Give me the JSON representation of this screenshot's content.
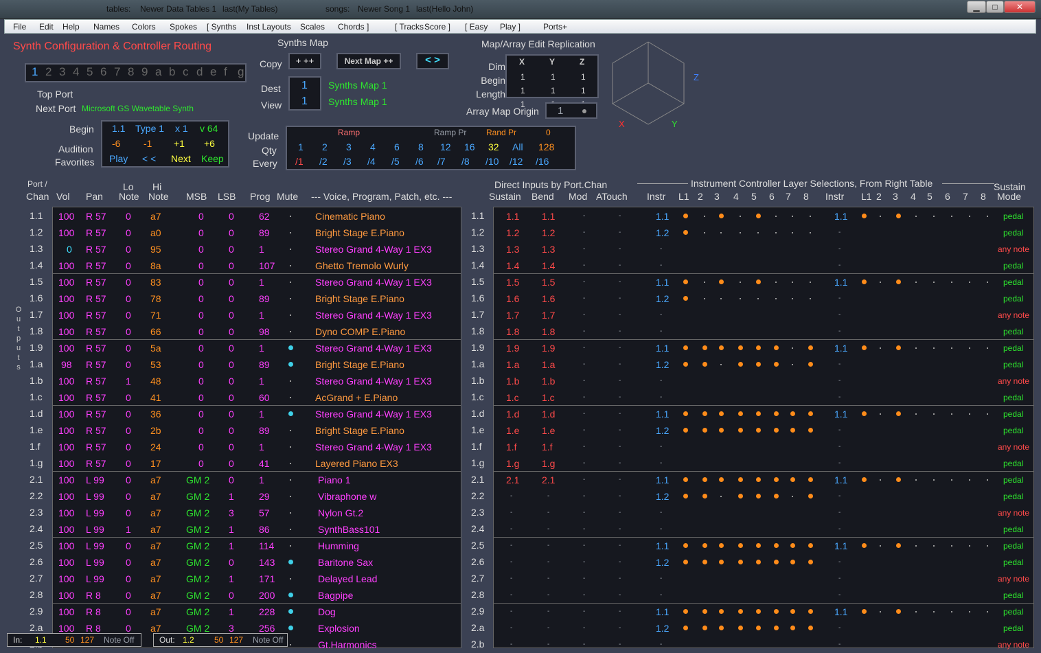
{
  "titlebar": {
    "tables_label": "tables:",
    "tables_value": "Newer Data Tables 1",
    "tables_last": "last(My Tables)",
    "songs_label": "songs:",
    "songs_value": "Newer Song 1",
    "songs_last": "last(Hello John)",
    "minimize": "▁",
    "maximize": "□",
    "close": "✕"
  },
  "menu": [
    "File",
    "Edit",
    "Help",
    "Names",
    "Colors",
    "Spokes",
    "[  Synths",
    "Inst Layouts",
    "Scales",
    "Chords  ]",
    "[  Tracks",
    "Score  ]",
    "[  Easy",
    "Play  ]",
    "Ports+"
  ],
  "config": {
    "title": "Synth Configuration & Controller Routing",
    "ports": [
      "1",
      "2",
      "3",
      "4",
      "5",
      "6",
      "7",
      "8",
      "9",
      "a",
      "b",
      "c",
      "d",
      "e",
      "f",
      "g"
    ],
    "top_port_label": "Top Port",
    "next_port_label": "Next Port",
    "next_port_value": "Microsoft GS Wavetable Synth",
    "begin_label": "Begin",
    "audition_label": "Audition",
    "favorites_label": "Favorites",
    "begin_vals": [
      "1.1",
      "Type 1",
      "x 1",
      "v 64"
    ],
    "audition_vals": [
      "-6",
      "-1",
      "+1",
      "+6"
    ],
    "fav_vals": [
      "Play",
      "<  <",
      "Next",
      "Keep"
    ]
  },
  "synthsmap": {
    "title": "Synths Map",
    "copy_label": "Copy",
    "copy_btn": "+  ++",
    "next_map_btn": "Next Map ++",
    "nav_btn": "<  >",
    "dest_label": "Dest",
    "view_label": "View",
    "dest_value": "1",
    "view_value": "1",
    "dest_name": "Synths Map 1",
    "view_name": "Synths Map 1"
  },
  "replication": {
    "title": "Map/Array Edit Replication",
    "headers": [
      "X",
      "Y",
      "Z"
    ],
    "rows": [
      {
        "label": "Dim",
        "vals": [
          "1",
          "1",
          "1"
        ]
      },
      {
        "label": "Begin",
        "vals": [
          "1",
          "1",
          "1"
        ]
      },
      {
        "label": "Length",
        "vals": [
          "1",
          "1",
          "1"
        ]
      }
    ],
    "origin_label": "Array Map Origin",
    "origin_value": "1",
    "axis_x": "X",
    "axis_y": "Y",
    "axis_z": "Z"
  },
  "update": {
    "update_label": "Update",
    "qty_label": "Qty",
    "every_label": "Every",
    "ramp": "Ramp",
    "ramp_pr": "Ramp Pr",
    "rand_pr": "Rand Pr",
    "zero": "0",
    "qty": [
      "1",
      "2",
      "3",
      "4",
      "6",
      "8",
      "12",
      "16",
      "32",
      "All",
      "128"
    ],
    "every": [
      "/1",
      "/2",
      "/3",
      "/4",
      "/5",
      "/6",
      "/7",
      "/8",
      "/10",
      "/12",
      "/16"
    ]
  },
  "left_headers": {
    "port": "Port /",
    "chan": "Chan",
    "vol": "Vol",
    "pan": "Pan",
    "lo1": "Lo",
    "lo2": "Note",
    "hi1": "Hi",
    "hi2": "Note",
    "msb": "MSB",
    "lsb": "LSB",
    "prog": "Prog",
    "mute": "Mute",
    "voice": "--- Voice, Program, Patch, etc. ---",
    "outputs": "Outputs"
  },
  "right_headers": {
    "direct": "Direct Inputs by Port.Chan",
    "sustain": "Sustain",
    "bend": "Bend",
    "mod": "Mod",
    "atouch": "ATouch",
    "layer_title": "Instrument Controller Layer Selections, From Right Table",
    "instr": "Instr",
    "layers": [
      "L1",
      "2",
      "3",
      "4",
      "5",
      "6",
      "7",
      "8"
    ],
    "sustain_mode1": "Sustain",
    "sustain_mode2": "Mode"
  },
  "rows": [
    {
      "pc": "1.1",
      "vol": "100",
      "pan": "R 57",
      "lo": "0",
      "hi": "a7",
      "msb": "0",
      "lsb": "0",
      "prog": "62",
      "mute": 0,
      "voice": "Cinematic Piano",
      "di": 1,
      "inst": "1.1",
      "lyr": "10101000",
      "inst2": "1.1",
      "lyr2": "10100000",
      "mode": "pedal"
    },
    {
      "pc": "1.2",
      "vol": "100",
      "pan": "R 57",
      "lo": "0",
      "hi": "a0",
      "msb": "0",
      "lsb": "0",
      "prog": "89",
      "mute": 0,
      "voice": "Bright Stage E.Piano",
      "di": 1,
      "inst": "1.2",
      "lyr": "10000000",
      "inst2": "",
      "lyr2": "",
      "mode": "pedal"
    },
    {
      "pc": "1.3",
      "vol": "0",
      "pan": "R 57",
      "lo": "0",
      "hi": "95",
      "msb": "0",
      "lsb": "0",
      "prog": "1",
      "mute": 0,
      "voice": "Stereo Grand 4-Way 1 EX3",
      "di": 1,
      "inst": "",
      "lyr": "",
      "inst2": "",
      "lyr2": "",
      "mode": "any note"
    },
    {
      "pc": "1.4",
      "vol": "100",
      "pan": "R 57",
      "lo": "0",
      "hi": "8a",
      "msb": "0",
      "lsb": "0",
      "prog": "107",
      "mute": 0,
      "voice": "Ghetto Tremolo Wurly",
      "di": 1,
      "inst": "",
      "lyr": "",
      "inst2": "",
      "lyr2": "",
      "mode": "pedal"
    },
    {
      "pc": "1.5",
      "vol": "100",
      "pan": "R 57",
      "lo": "0",
      "hi": "83",
      "msb": "0",
      "lsb": "0",
      "prog": "1",
      "mute": 0,
      "voice": "Stereo Grand 4-Way 1 EX3",
      "di": 1,
      "inst": "1.1",
      "lyr": "10101000",
      "inst2": "1.1",
      "lyr2": "10100000",
      "mode": "pedal"
    },
    {
      "pc": "1.6",
      "vol": "100",
      "pan": "R 57",
      "lo": "0",
      "hi": "78",
      "msb": "0",
      "lsb": "0",
      "prog": "89",
      "mute": 0,
      "voice": "Bright Stage E.Piano",
      "di": 1,
      "inst": "1.2",
      "lyr": "10000000",
      "inst2": "",
      "lyr2": "",
      "mode": "pedal"
    },
    {
      "pc": "1.7",
      "vol": "100",
      "pan": "R 57",
      "lo": "0",
      "hi": "71",
      "msb": "0",
      "lsb": "0",
      "prog": "1",
      "mute": 0,
      "voice": "Stereo Grand 4-Way 1 EX3",
      "di": 1,
      "inst": "",
      "lyr": "",
      "inst2": "",
      "lyr2": "",
      "mode": "any note"
    },
    {
      "pc": "1.8",
      "vol": "100",
      "pan": "R 57",
      "lo": "0",
      "hi": "66",
      "msb": "0",
      "lsb": "0",
      "prog": "98",
      "mute": 0,
      "voice": "Dyno COMP E.Piano",
      "di": 1,
      "inst": "",
      "lyr": "",
      "inst2": "",
      "lyr2": "",
      "mode": "pedal"
    },
    {
      "pc": "1.9",
      "vol": "100",
      "pan": "R 57",
      "lo": "0",
      "hi": "5a",
      "msb": "0",
      "lsb": "0",
      "prog": "1",
      "mute": 1,
      "voice": "Stereo Grand 4-Way 1 EX3",
      "di": 1,
      "inst": "1.1",
      "lyr": "11111101",
      "inst2": "1.1",
      "lyr2": "10100000",
      "mode": "pedal"
    },
    {
      "pc": "1.a",
      "vol": "98",
      "pan": "R 57",
      "lo": "0",
      "hi": "53",
      "msb": "0",
      "lsb": "0",
      "prog": "89",
      "mute": 1,
      "voice": "Bright Stage E.Piano",
      "di": 1,
      "inst": "1.2",
      "lyr": "11011101",
      "inst2": "",
      "lyr2": "",
      "mode": "pedal"
    },
    {
      "pc": "1.b",
      "vol": "100",
      "pan": "R 57",
      "lo": "1",
      "hi": "48",
      "msb": "0",
      "lsb": "0",
      "prog": "1",
      "mute": 0,
      "voice": "Stereo Grand 4-Way 1 EX3",
      "di": 1,
      "inst": "",
      "lyr": "",
      "inst2": "",
      "lyr2": "",
      "mode": "any note"
    },
    {
      "pc": "1.c",
      "vol": "100",
      "pan": "R 57",
      "lo": "0",
      "hi": "41",
      "msb": "0",
      "lsb": "0",
      "prog": "60",
      "mute": 0,
      "voice": "AcGrand + E.Piano",
      "di": 1,
      "inst": "",
      "lyr": "",
      "inst2": "",
      "lyr2": "",
      "mode": "pedal"
    },
    {
      "pc": "1.d",
      "vol": "100",
      "pan": "R 57",
      "lo": "0",
      "hi": "36",
      "msb": "0",
      "lsb": "0",
      "prog": "1",
      "mute": 1,
      "voice": "Stereo Grand 4-Way 1 EX3",
      "di": 1,
      "inst": "1.1",
      "lyr": "11111111",
      "inst2": "1.1",
      "lyr2": "10100000",
      "mode": "pedal"
    },
    {
      "pc": "1.e",
      "vol": "100",
      "pan": "R 57",
      "lo": "0",
      "hi": "2b",
      "msb": "0",
      "lsb": "0",
      "prog": "89",
      "mute": 0,
      "voice": "Bright Stage E.Piano",
      "di": 1,
      "inst": "1.2",
      "lyr": "11111111",
      "inst2": "",
      "lyr2": "",
      "mode": "pedal"
    },
    {
      "pc": "1.f",
      "vol": "100",
      "pan": "R 57",
      "lo": "0",
      "hi": "24",
      "msb": "0",
      "lsb": "0",
      "prog": "1",
      "mute": 0,
      "voice": "Stereo Grand 4-Way 1 EX3",
      "di": 1,
      "inst": "",
      "lyr": "",
      "inst2": "",
      "lyr2": "",
      "mode": "any note"
    },
    {
      "pc": "1.g",
      "vol": "100",
      "pan": "R 57",
      "lo": "0",
      "hi": "17",
      "msb": "0",
      "lsb": "0",
      "prog": "41",
      "mute": 0,
      "voice": "Layered Piano EX3",
      "di": 1,
      "inst": "",
      "lyr": "",
      "inst2": "",
      "lyr2": "",
      "mode": "pedal"
    },
    {
      "pc": "2.1",
      "vol": "100",
      "pan": "L 99",
      "lo": "0",
      "hi": "a7",
      "msb": "GM 2",
      "lsb": "0",
      "prog": "1",
      "mute": 0,
      "voice": "Piano 1",
      "di": 1,
      "inst": "1.1",
      "lyr": "11111111",
      "inst2": "1.1",
      "lyr2": "10100000",
      "mode": "pedal"
    },
    {
      "pc": "2.2",
      "vol": "100",
      "pan": "L 99",
      "lo": "0",
      "hi": "a7",
      "msb": "GM 2",
      "lsb": "1",
      "prog": "29",
      "mute": 0,
      "voice": "Vibraphone w",
      "di": 0,
      "inst": "1.2",
      "lyr": "11011101",
      "inst2": "",
      "lyr2": "",
      "mode": "pedal"
    },
    {
      "pc": "2.3",
      "vol": "100",
      "pan": "L 99",
      "lo": "0",
      "hi": "a7",
      "msb": "GM 2",
      "lsb": "3",
      "prog": "57",
      "mute": 0,
      "voice": "Nylon Gt.2",
      "di": 0,
      "inst": "",
      "lyr": "",
      "inst2": "",
      "lyr2": "",
      "mode": "any note"
    },
    {
      "pc": "2.4",
      "vol": "100",
      "pan": "L 99",
      "lo": "1",
      "hi": "a7",
      "msb": "GM 2",
      "lsb": "1",
      "prog": "86",
      "mute": 0,
      "voice": "SynthBass101",
      "di": 0,
      "inst": "",
      "lyr": "",
      "inst2": "",
      "lyr2": "",
      "mode": "pedal"
    },
    {
      "pc": "2.5",
      "vol": "100",
      "pan": "L 99",
      "lo": "0",
      "hi": "a7",
      "msb": "GM 2",
      "lsb": "1",
      "prog": "114",
      "mute": 0,
      "voice": "Humming",
      "di": 0,
      "inst": "1.1",
      "lyr": "11111111",
      "inst2": "1.1",
      "lyr2": "10100000",
      "mode": "pedal"
    },
    {
      "pc": "2.6",
      "vol": "100",
      "pan": "L 99",
      "lo": "0",
      "hi": "a7",
      "msb": "GM 2",
      "lsb": "0",
      "prog": "143",
      "mute": 1,
      "voice": "Baritone Sax",
      "di": 0,
      "inst": "1.2",
      "lyr": "11111111",
      "inst2": "",
      "lyr2": "",
      "mode": "pedal"
    },
    {
      "pc": "2.7",
      "vol": "100",
      "pan": "L 99",
      "lo": "0",
      "hi": "a7",
      "msb": "GM 2",
      "lsb": "1",
      "prog": "171",
      "mute": 0,
      "voice": "Delayed Lead",
      "di": 0,
      "inst": "",
      "lyr": "",
      "inst2": "",
      "lyr2": "",
      "mode": "any note"
    },
    {
      "pc": "2.8",
      "vol": "100",
      "pan": "R  8",
      "lo": "0",
      "hi": "a7",
      "msb": "GM 2",
      "lsb": "0",
      "prog": "200",
      "mute": 1,
      "voice": "Bagpipe",
      "di": 0,
      "inst": "",
      "lyr": "",
      "inst2": "",
      "lyr2": "",
      "mode": "pedal"
    },
    {
      "pc": "2.9",
      "vol": "100",
      "pan": "R  8",
      "lo": "0",
      "hi": "a7",
      "msb": "GM 2",
      "lsb": "1",
      "prog": "228",
      "mute": 1,
      "voice": "Dog",
      "di": 0,
      "inst": "1.1",
      "lyr": "11111111",
      "inst2": "1.1",
      "lyr2": "10100000",
      "mode": "pedal"
    },
    {
      "pc": "2.a",
      "vol": "100",
      "pan": "R  8",
      "lo": "0",
      "hi": "a7",
      "msb": "GM 2",
      "lsb": "3",
      "prog": "256",
      "mute": 1,
      "voice": "Explosion",
      "di": 0,
      "inst": "1.2",
      "lyr": "11111111",
      "inst2": "",
      "lyr2": "",
      "mode": "pedal"
    },
    {
      "pc": "2.b",
      "vol": "",
      "pan": "",
      "lo": "",
      "hi": "",
      "msb": "",
      "lsb": "",
      "prog": "",
      "mute": 0,
      "voice": "Gt.Harmonics",
      "di": 0,
      "inst": "",
      "lyr": "",
      "inst2": "",
      "lyr2": "",
      "mode": "any note"
    }
  ],
  "status_in": {
    "label": "In:",
    "pc": "1.1",
    "a": "50",
    "b": "127",
    "msg": "Note Off"
  },
  "status_out": {
    "label": "Out:",
    "pc": "1.2",
    "a": "50",
    "b": "127",
    "msg": "Note Off"
  }
}
